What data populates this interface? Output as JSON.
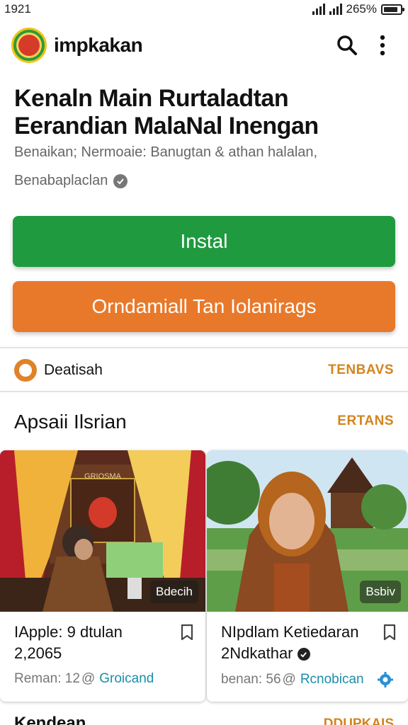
{
  "status": {
    "time": "1921",
    "battery": "265%",
    "battery_level": 0.85
  },
  "app": {
    "name": "impkakan"
  },
  "headline": "Kenaln Main Rurtaladtan Eerandian MalaNal Inengan",
  "meta": "Benaikan; Nermoaie: Banugtan & athan halalan,",
  "publisher": "Benabaplaclan",
  "buttons": {
    "install": "Instal",
    "secondary": "Orndamiall Tan Iolanirags"
  },
  "row": {
    "label": "Deatisah",
    "link": "TENBAVS"
  },
  "section": {
    "title": "Apsaii Ilsrian",
    "link": "ERTANS"
  },
  "cards": [
    {
      "badge": "Bdecih",
      "title": "IApple: 9 dtulan 2,2065",
      "meta": "Reman: 12",
      "source": "Groicand",
      "image_caption": "GRIOSMA"
    },
    {
      "badge": "Bsbiv",
      "title": "NIpdlam Ketiedaran 2Ndkathar",
      "meta": "benan: 56",
      "source": "Rcnobican"
    }
  ],
  "next_section": {
    "title": "Kendean",
    "link": "DDUPKAIS"
  },
  "colors": {
    "install": "#1f9a3f",
    "secondary": "#e8792a",
    "accent": "#d4841e",
    "link": "#1a8fa8"
  },
  "icons": [
    "search-icon",
    "more-vert-icon",
    "verified-icon",
    "bookmark-icon",
    "settings-icon"
  ]
}
